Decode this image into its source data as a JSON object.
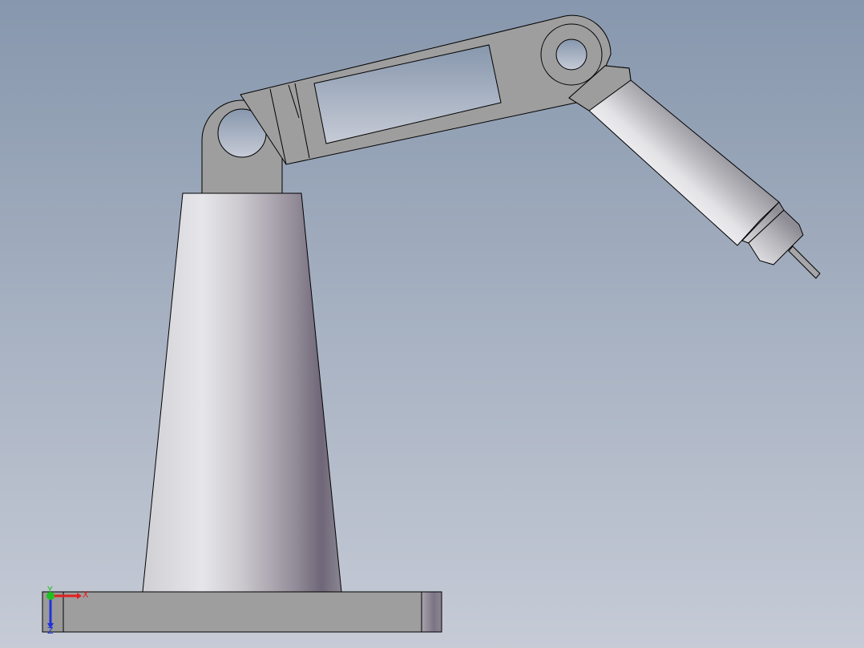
{
  "viewport": {
    "background_top": "#8a9bb1",
    "background_bottom": "#c7ccd6"
  },
  "model": {
    "name": "robotic-arm",
    "body_color": "#9e9e9e",
    "outline_color": "#000000"
  },
  "triad": {
    "x_label": "X",
    "y_label": "Y",
    "z_label": "Z",
    "x_color": "#e02020",
    "y_color": "#20c020",
    "z_color": "#2030e0"
  }
}
